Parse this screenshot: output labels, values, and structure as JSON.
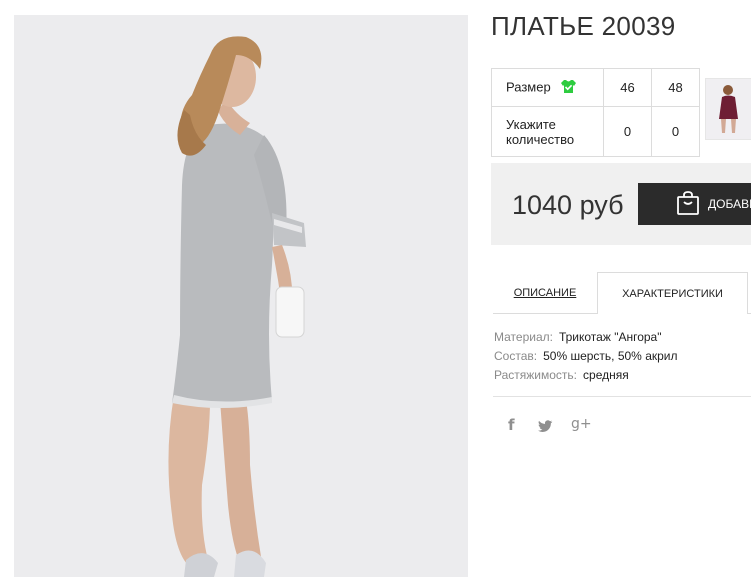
{
  "product": {
    "title": "ПЛАТЬЕ 20039",
    "image_alt": "model-in-grey-dress"
  },
  "size_table": {
    "size_label": "Размер",
    "quantity_label": "Укажите количество",
    "sizes": [
      "46",
      "48"
    ],
    "quantities": [
      "0",
      "0"
    ],
    "size_icon": "shirt-icon",
    "icon_color": "#2ecc40"
  },
  "thumbnail": {
    "icon": "product-thumbnail",
    "dress_color": "#6e1e34"
  },
  "purchase": {
    "price": "1040 руб",
    "add_button_label": "ДОБАВИТЬ В КОРЗИНУ",
    "add_button_icon": "shopping-bag-icon"
  },
  "tabs": {
    "description": "ОПИСАНИЕ",
    "characteristics": "ХАРАКТЕРИСТИКИ",
    "active": "characteristics"
  },
  "characteristics": [
    {
      "key": "Материал:",
      "value": "Трикотаж \"Ангора\""
    },
    {
      "key": "Состав:",
      "value": "50% шерсть, 50% акрил"
    },
    {
      "key": "Растяжимость:",
      "value": "средняя"
    }
  ],
  "social": {
    "facebook": "f",
    "twitter": "twitter-icon",
    "google_plus": "g+"
  }
}
